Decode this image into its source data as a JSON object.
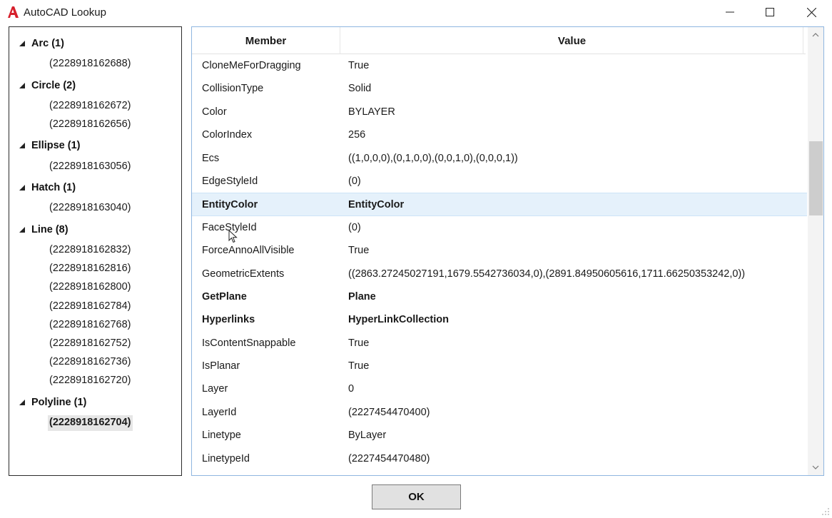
{
  "window": {
    "title": "AutoCAD Lookup",
    "app_icon": "autocad-a-icon",
    "controls": [
      "minimize-icon",
      "maximize-icon",
      "close-icon"
    ]
  },
  "tree": {
    "groups": [
      {
        "label": "Arc (1)",
        "children": [
          "(2228918162688)"
        ]
      },
      {
        "label": "Circle (2)",
        "children": [
          "(2228918162672)",
          "(2228918162656)"
        ]
      },
      {
        "label": "Ellipse (1)",
        "children": [
          "(2228918163056)"
        ]
      },
      {
        "label": "Hatch (1)",
        "children": [
          "(2228918163040)"
        ]
      },
      {
        "label": "Line (8)",
        "children": [
          "(2228918162832)",
          "(2228918162816)",
          "(2228918162800)",
          "(2228918162784)",
          "(2228918162768)",
          "(2228918162752)",
          "(2228918162736)",
          "(2228918162720)"
        ]
      },
      {
        "label": "Polyline (1)",
        "children": [
          "(2228918162704)"
        ]
      }
    ],
    "selected": "(2228918162704)"
  },
  "grid": {
    "headers": {
      "member": "Member",
      "value": "Value"
    },
    "rows": [
      {
        "member": "CloneMeForDragging",
        "value": "True"
      },
      {
        "member": "CollisionType",
        "value": "Solid"
      },
      {
        "member": "Color",
        "value": "BYLAYER"
      },
      {
        "member": "ColorIndex",
        "value": "256"
      },
      {
        "member": "Ecs",
        "value": "((1,0,0,0),(0,1,0,0),(0,0,1,0),(0,0,0,1))"
      },
      {
        "member": "EdgeStyleId",
        "value": "(0)"
      },
      {
        "member": "EntityColor",
        "value": "EntityColor"
      },
      {
        "member": "FaceStyleId",
        "value": "(0)"
      },
      {
        "member": "ForceAnnoAllVisible",
        "value": "True"
      },
      {
        "member": "GeometricExtents",
        "value": "((2863.27245027191,1679.5542736034,0),(2891.84950605616,1711.66250353242,0))"
      },
      {
        "member": "GetPlane",
        "value": "Plane"
      },
      {
        "member": "Hyperlinks",
        "value": "HyperLinkCollection"
      },
      {
        "member": "IsContentSnappable",
        "value": "True"
      },
      {
        "member": "IsPlanar",
        "value": "True"
      },
      {
        "member": "Layer",
        "value": "0"
      },
      {
        "member": "LayerId",
        "value": "(2227454470400)"
      },
      {
        "member": "Linetype",
        "value": "ByLayer"
      },
      {
        "member": "LinetypeId",
        "value": "(2227454470480)"
      }
    ]
  },
  "buttons": {
    "ok": "OK"
  },
  "colors": {
    "accent_border": "#8fb6e0",
    "row_highlight": "#e5f1fb",
    "autocad_red": "#d6202c"
  }
}
